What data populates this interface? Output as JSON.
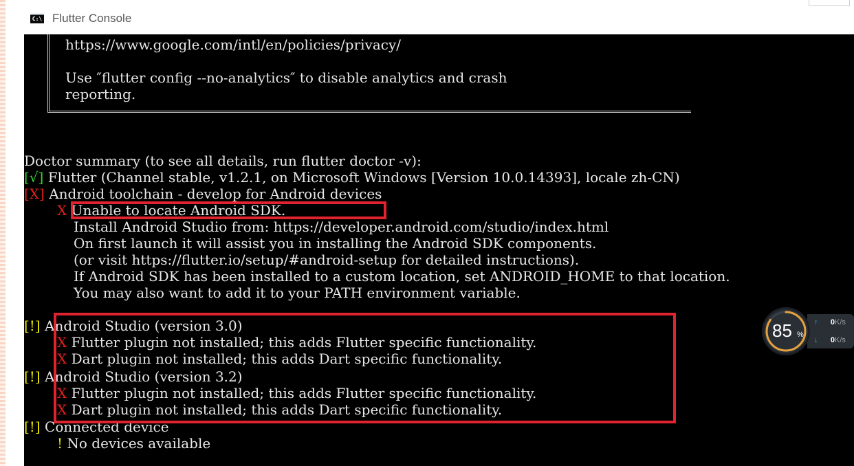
{
  "window": {
    "title": "Flutter Console",
    "icon": "console-icon"
  },
  "console": {
    "analytics": {
      "url_line": "https://www.google.com/intl/en/policies/privacy/",
      "use_line": "Use ″flutter config --no-analytics″ to disable analytics and crash",
      "reporting_line": "reporting."
    },
    "summary_header": "Doctor summary (to see all details, run flutter doctor -v):",
    "flutter": {
      "mark": "[√]",
      "text": "Flutter (Channel stable, v1.2.1, on Microsoft Windows [Version 10.0.14393], locale zh-CN)"
    },
    "android_toolchain": {
      "mark": "[X]",
      "text": "Android toolchain - develop for Android devices",
      "error_mark": "X",
      "error": "Unable to locate Android SDK.",
      "details": [
        "Install Android Studio from: https://developer.android.com/studio/index.html",
        "On first launch it will assist you in installing the Android SDK components.",
        "(or visit https://flutter.io/setup/#android-setup for detailed instructions).",
        "If Android SDK has been installed to a custom location, set ANDROID_HOME to that location.",
        "You may also want to add it to your PATH environment variable."
      ]
    },
    "studio_30": {
      "mark": "[!]",
      "text": "Android Studio (version 3.0)",
      "items": [
        {
          "mark": "X",
          "text": "Flutter plugin not installed; this adds Flutter specific functionality."
        },
        {
          "mark": "X",
          "text": "Dart plugin not installed; this adds Dart specific functionality."
        }
      ]
    },
    "studio_32": {
      "mark": "[!]",
      "text": "Android Studio (version 3.2)",
      "items": [
        {
          "mark": "X",
          "text": "Flutter plugin not installed; this adds Flutter specific functionality."
        },
        {
          "mark": "X",
          "text": "Dart plugin not installed; this adds Dart specific functionality."
        }
      ]
    },
    "connected": {
      "mark": "[!]",
      "text": "Connected device",
      "item_mark": "!",
      "item": "No devices available"
    }
  },
  "widget": {
    "gauge_value": "85",
    "gauge_unit": "%",
    "gauge_fraction": 0.85,
    "upload": {
      "value": "0",
      "unit": "K/s"
    },
    "download": {
      "value": "0",
      "unit": "K/s"
    }
  },
  "colors": {
    "ok": "#2fd62f",
    "error": "#e02020",
    "warning": "#e8e800",
    "highlight": "#e0232e",
    "console_bg": "#000000"
  }
}
